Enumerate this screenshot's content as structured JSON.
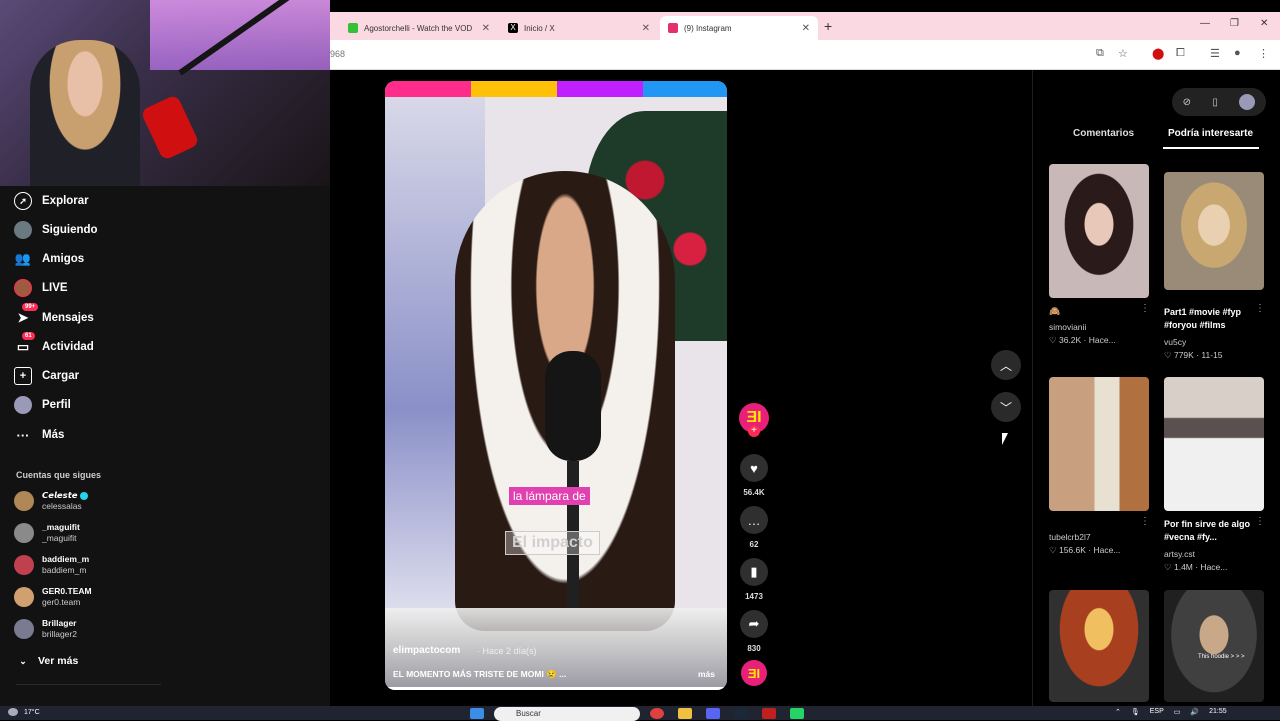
{
  "browser": {
    "tabs": [
      {
        "label": "Agostorchelli - Watch the VOD",
        "icon_color": "#35c135"
      },
      {
        "label": "Inicio / X",
        "icon_color": "#000000"
      },
      {
        "label": "(9) Instagram",
        "icon_color": "#e1306c"
      }
    ],
    "url_fragment": "968",
    "new_tab_icon": "plus-icon",
    "window_controls": [
      "minimize-icon",
      "restore-icon",
      "close-icon"
    ]
  },
  "sidebar": {
    "nav": [
      {
        "label": "Explorar",
        "icon": "compass-icon"
      },
      {
        "label": "Siguiendo",
        "icon": "avatar"
      },
      {
        "label": "Amigos",
        "icon": "friends-icon"
      },
      {
        "label": "LIVE",
        "icon": "avatar"
      },
      {
        "label": "Mensajes",
        "icon": "send-icon",
        "badge": "99+"
      },
      {
        "label": "Actividad",
        "icon": "inbox-icon",
        "badge": "61"
      },
      {
        "label": "Cargar",
        "icon": "upload-icon"
      },
      {
        "label": "Perfil",
        "icon": "avatar"
      },
      {
        "label": "Más",
        "icon": "ellipsis-icon"
      }
    ],
    "following_title": "Cuentas que sigues",
    "accounts": [
      {
        "name": "𝘾𝙚𝙡𝙚𝙨𝙩𝙚",
        "handle": "celessalas",
        "verified": true,
        "color": "#b08858"
      },
      {
        "name": "_maguifit",
        "handle": "_maguifit",
        "color": "#8a8a8a"
      },
      {
        "name": "baddiem_m",
        "handle": "baddiem_m",
        "color": "#c04050"
      },
      {
        "name": "GER0.TEAM",
        "handle": "ger0.team",
        "color": "#d0a070"
      },
      {
        "name": "Brillager",
        "handle": "brillager2",
        "color": "#7a7a90"
      }
    ],
    "see_more": "Ver más"
  },
  "video": {
    "caption_line1": "la lámpara de",
    "caption_line2": "El impacto",
    "author": "elimpactocom",
    "time": "· Hace 2 día(s)",
    "description": "EL MOMENTO MÁS TRISTE DE MOMI 😢 ...",
    "more_label": "más",
    "stripe_colors": [
      "#fe2c8a",
      "#ffc107",
      "#c020ff",
      "#2196f3"
    ]
  },
  "actions": {
    "likes": "56.4K",
    "comments": "62",
    "saves": "1473",
    "shares": "830",
    "brand_glyph": "ƎI"
  },
  "right_panel": {
    "tabs": [
      "Comentarios",
      "Podría interesarte"
    ],
    "active_tab": "Podría interesarte",
    "items": [
      {
        "title": "",
        "emoji": "🙈",
        "author": "simovianii",
        "meta": "♡ 36.2K · Hace...",
        "thumb": [
          "#2a1a1a",
          "#e8d0c8"
        ]
      },
      {
        "title": "Part1 #movie #fyp #foryou #films",
        "author": "vu5cy",
        "meta": "♡ 779K · 11-15",
        "thumb": [
          "#d8c8a0",
          "#8a7a68"
        ]
      },
      {
        "title": "",
        "author": "tubelcrb2l7",
        "meta": "♡ 156.6K · Hace...",
        "thumb": [
          "#c8a080",
          "#4a3a30"
        ]
      },
      {
        "title": "Por fin sirve de algo #vecna #fy...",
        "author": "artsy.cst",
        "meta": "♡ 1.4M · Hace...",
        "thumb": [
          "#e8e8e8",
          "#606060"
        ]
      },
      {
        "title": "",
        "author": "",
        "meta": "",
        "thumb": [
          "#a84020",
          "#f0c060"
        ]
      },
      {
        "title": "",
        "author": "",
        "meta": "",
        "thumb": [
          "#303030",
          "#c8a888"
        ]
      }
    ],
    "thumb5_text": "",
    "thumb6_text": "This hoodie > > >"
  },
  "taskbar": {
    "weather": "17°C",
    "search_placeholder": "Buscar",
    "lang": "ESP",
    "time": "21:55"
  }
}
